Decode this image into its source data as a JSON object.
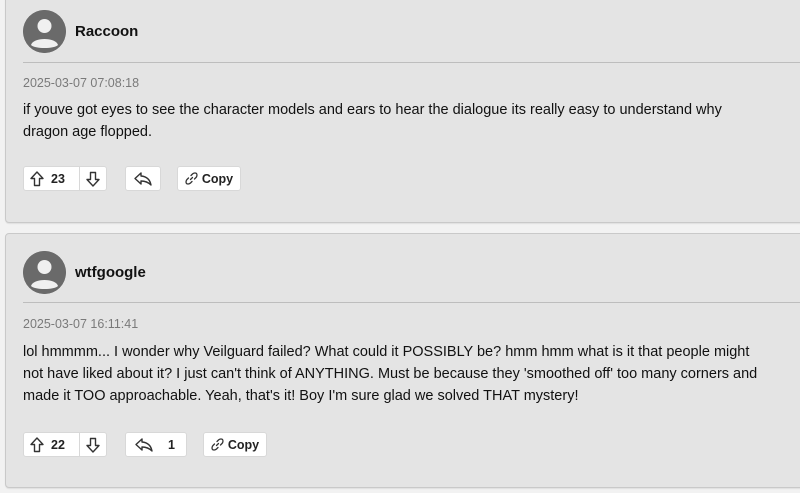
{
  "comments": [
    {
      "username": "Raccoon",
      "timestamp": "2025-03-07 07:08:18",
      "lines": [
        "if youve got eyes to see the character models and ears to hear the dialogue its really easy to understand why",
        "dragon age flopped."
      ],
      "upvotes": "23",
      "replies": "",
      "copy_label": "Copy"
    },
    {
      "username": "wtfgoogle",
      "timestamp": "2025-03-07 16:11:41",
      "lines": [
        "lol hmmmm... I wonder why Veilguard failed? What could it POSSIBLY be? hmm hmm what is it that people might",
        "not have liked about it? I just can't think of ANYTHING. Must be because they 'smoothed off' too many corners and",
        "made it TOO approachable. Yeah, that's it! Boy I'm sure glad we solved THAT mystery!"
      ],
      "upvotes": "22",
      "replies": "1",
      "copy_label": "Copy"
    }
  ],
  "icons": {
    "avatar": "user-avatar-icon",
    "upvote": "arrow-up-icon",
    "downvote": "arrow-down-icon",
    "reply": "reply-arrow-icon",
    "copy": "link-icon"
  },
  "colors": {
    "card_background": "#e4e4e4",
    "page_background": "#f2f2f2",
    "avatar": "#6a6a6a",
    "timestamp": "#7a7a7a"
  }
}
